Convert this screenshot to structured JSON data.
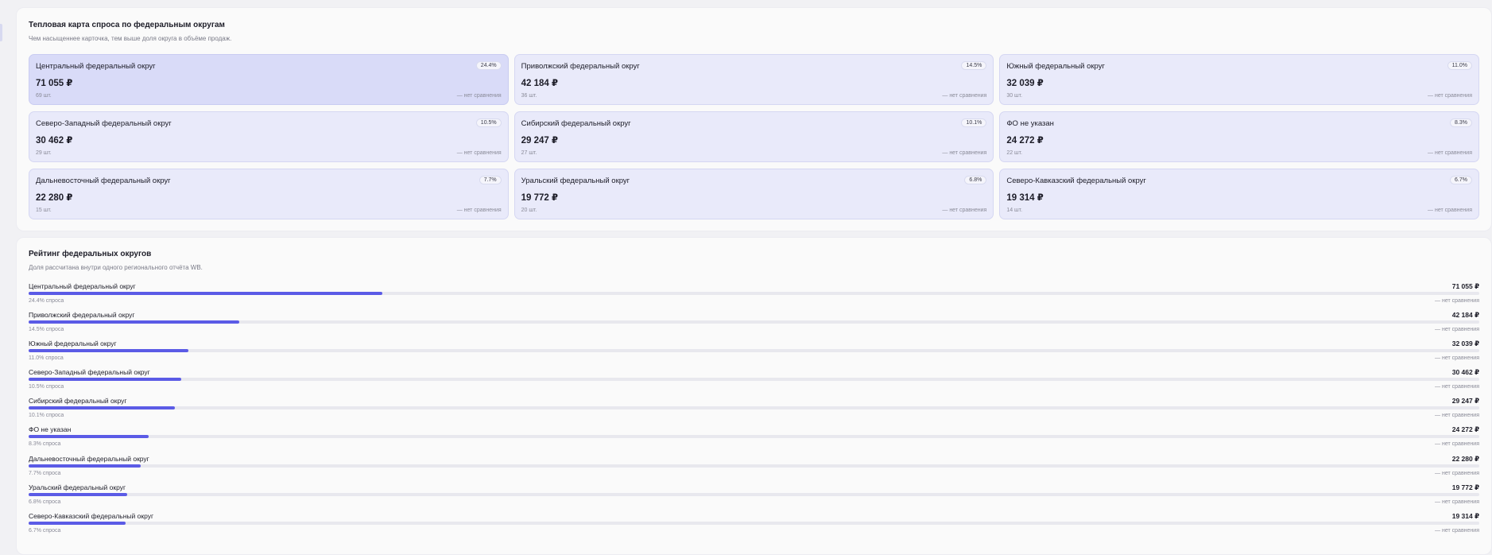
{
  "heatmap": {
    "title": "Тепловая карта спроса по федеральным округам",
    "subtitle": "Чем насыщеннее карточка, тем выше доля округа в объёме продаж.",
    "cards": [
      {
        "name": "Центральный федеральный округ",
        "pct": "24.4%",
        "value": "71 055 ₽",
        "qty": "69 шт.",
        "compare": "— нет сравнения"
      },
      {
        "name": "Приволжский федеральный округ",
        "pct": "14.5%",
        "value": "42 184 ₽",
        "qty": "36 шт.",
        "compare": "— нет сравнения"
      },
      {
        "name": "Южный федеральный округ",
        "pct": "11.0%",
        "value": "32 039 ₽",
        "qty": "30 шт.",
        "compare": "— нет сравнения"
      },
      {
        "name": "Северо-Западный федеральный округ",
        "pct": "10.5%",
        "value": "30 462 ₽",
        "qty": "29 шт.",
        "compare": "— нет сравнения"
      },
      {
        "name": "Сибирский федеральный округ",
        "pct": "10.1%",
        "value": "29 247 ₽",
        "qty": "27 шт.",
        "compare": "— нет сравнения"
      },
      {
        "name": "ФО не указан",
        "pct": "8.3%",
        "value": "24 272 ₽",
        "qty": "22 шт.",
        "compare": "— нет сравнения"
      },
      {
        "name": "Дальневосточный федеральный округ",
        "pct": "7.7%",
        "value": "22 280 ₽",
        "qty": "15 шт.",
        "compare": "— нет сравнения"
      },
      {
        "name": "Уральский федеральный округ",
        "pct": "6.8%",
        "value": "19 772 ₽",
        "qty": "20 шт.",
        "compare": "— нет сравнения"
      },
      {
        "name": "Северо-Кавказский федеральный округ",
        "pct": "6.7%",
        "value": "19 314 ₽",
        "qty": "14 шт.",
        "compare": "— нет сравнения"
      }
    ]
  },
  "rating": {
    "title": "Рейтинг федеральных округов",
    "subtitle": "Доля рассчитана внутри одного регионального отчёта WB.",
    "bar_color": "#5b5be6",
    "rows": [
      {
        "name": "Центральный федеральный округ",
        "share": 0.244,
        "share_label": "24.4% спроса",
        "value": "71 055 ₽",
        "compare": "— нет сравнения"
      },
      {
        "name": "Приволжский федеральный округ",
        "share": 0.145,
        "share_label": "14.5% спроса",
        "value": "42 184 ₽",
        "compare": "— нет сравнения"
      },
      {
        "name": "Южный федеральный округ",
        "share": 0.11,
        "share_label": "11.0% спроса",
        "value": "32 039 ₽",
        "compare": "— нет сравнения"
      },
      {
        "name": "Северо-Западный федеральный округ",
        "share": 0.105,
        "share_label": "10.5% спроса",
        "value": "30 462 ₽",
        "compare": "— нет сравнения"
      },
      {
        "name": "Сибирский федеральный округ",
        "share": 0.101,
        "share_label": "10.1% спроса",
        "value": "29 247 ₽",
        "compare": "— нет сравнения"
      },
      {
        "name": "ФО не указан",
        "share": 0.083,
        "share_label": "8.3% спроса",
        "value": "24 272 ₽",
        "compare": "— нет сравнения"
      },
      {
        "name": "Дальневосточный федеральный округ",
        "share": 0.077,
        "share_label": "7.7% спроса",
        "value": "22 280 ₽",
        "compare": "— нет сравнения"
      },
      {
        "name": "Уральский федеральный округ",
        "share": 0.068,
        "share_label": "6.8% спроса",
        "value": "19 772 ₽",
        "compare": "— нет сравнения"
      },
      {
        "name": "Северо-Кавказский федеральный округ",
        "share": 0.067,
        "share_label": "6.7% спроса",
        "value": "19 314 ₽",
        "compare": "— нет сравнения"
      }
    ]
  }
}
